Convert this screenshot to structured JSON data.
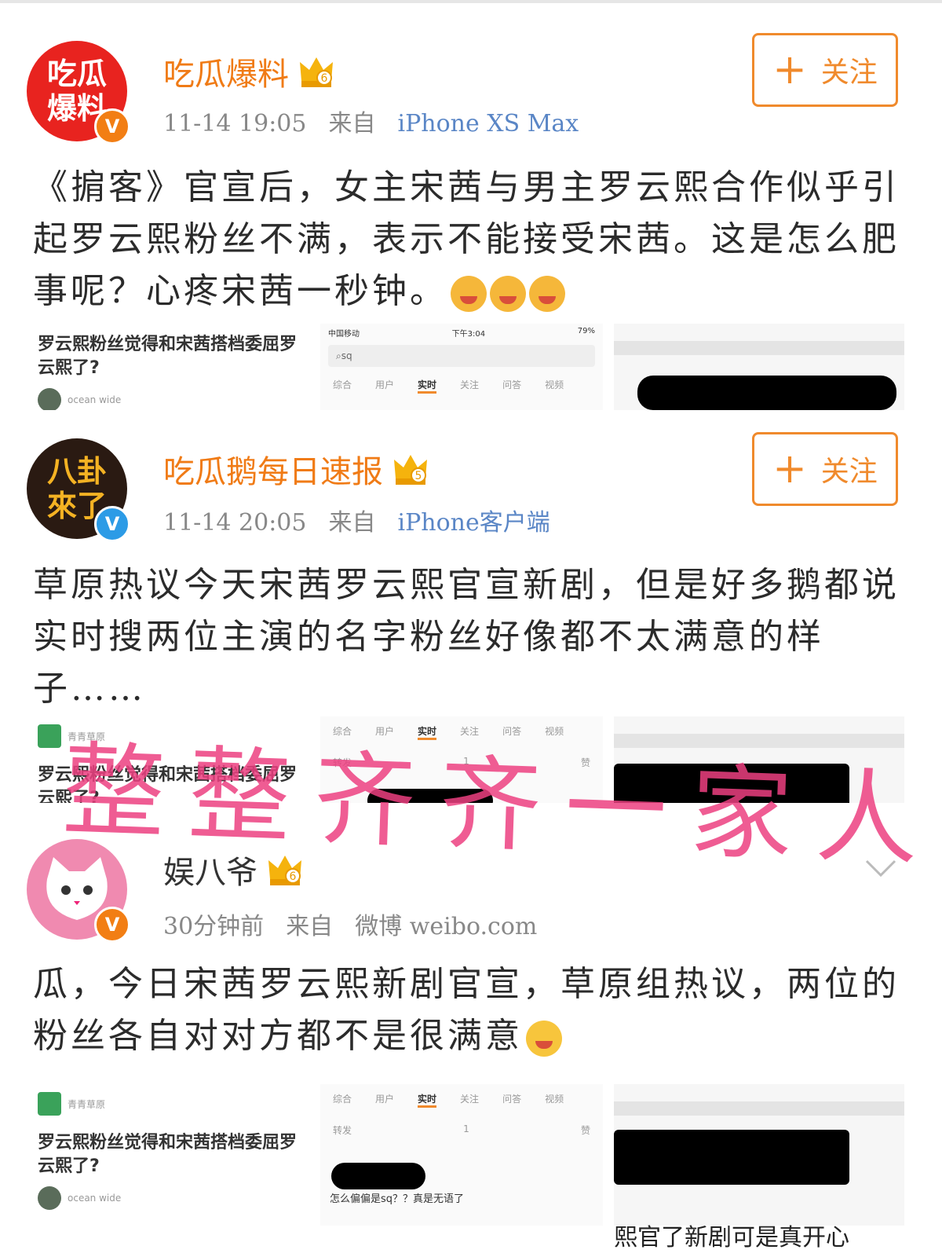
{
  "posts": [
    {
      "author": "吃瓜爆料",
      "avatar_text": "吃瓜\n爆料",
      "level": "6",
      "time": "11-14 19:05",
      "from": "来自",
      "source": "iPhone XS Max",
      "follow_label": "关注",
      "text": "《掮客》官宣后，女主宋茜与男主罗云熙合作似乎引起罗云熙粉丝不满，表示不能接受宋茜。这是怎么肥事呢？心疼宋茜一秒钟。",
      "thumb_title": "罗云熙粉丝觉得和宋茜搭档委屈罗云熙了?",
      "thumb_user": "ocean wide",
      "phone_status": {
        "carrier": "中国移动",
        "time": "下午3:04",
        "battery": "79%"
      },
      "search_value": "sq",
      "tabs": [
        "综合",
        "用户",
        "实时",
        "关注",
        "问答",
        "视频"
      ]
    },
    {
      "author": "吃瓜鹅每日速报",
      "avatar_text": "八卦\n來了",
      "level": "5",
      "time": "11-14 20:05",
      "from": "来自",
      "source": "iPhone客户端",
      "follow_label": "关注",
      "text": "草原热议今天宋茜罗云熙官宣新剧，但是好多鹅都说实时搜两位主演的名字粉丝好像都不太满意的样子……",
      "thumb_user": "青青草原",
      "thumb_title": "罗云熙粉丝觉得和宋茜搭档委屈罗云熙了?",
      "tabs": [
        "综合",
        "用户",
        "实时",
        "关注",
        "问答",
        "视频"
      ],
      "actions": [
        "转发",
        "1",
        "赞"
      ]
    },
    {
      "author": "娱八爷",
      "level": "6",
      "time": "30分钟前",
      "from": "来自",
      "source": "微博 weibo.com",
      "text": "瓜，今日宋茜罗云熙新剧官宣，草原组热议，两位的粉丝各自对对方都不是很满意",
      "thumb_user": "青青草原",
      "thumb_title": "罗云熙粉丝觉得和宋茜搭档委屈罗云熙了?",
      "thumb_user2": "ocean wide",
      "tabs": [
        "综合",
        "用户",
        "实时",
        "关注",
        "问答",
        "视频"
      ],
      "actions": [
        "转发",
        "1",
        "赞"
      ],
      "comment": "怎么偏偏是sq？？真是无语了",
      "caption": "熙官了新剧可是真开心"
    }
  ],
  "watermark": "整整齐齐一家人",
  "colors": {
    "accent": "#f08a2c",
    "link": "#5a86c6",
    "watermark": "#ec4080"
  }
}
